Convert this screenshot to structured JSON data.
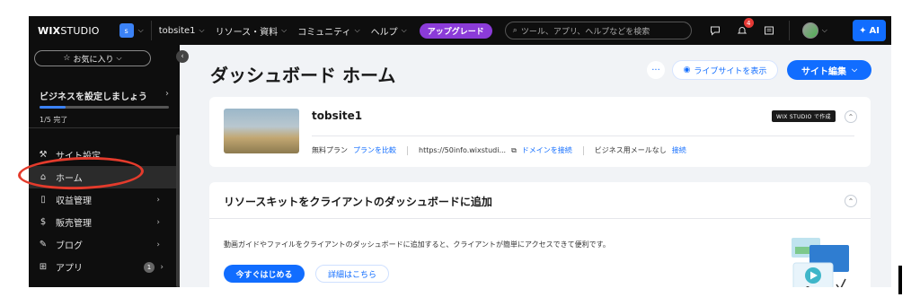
{
  "topbar": {
    "logo_bold": "WIX",
    "logo_light": "STUDIO",
    "workspace_initial": "s",
    "site_selector": "tobsite1",
    "nav": [
      "リソース・資料",
      "コミュニティ",
      "ヘルプ"
    ],
    "upgrade": "アップグレード",
    "search_placeholder": "ツール、アプリ、ヘルプなどを検索",
    "notifications_count": "4",
    "ai_label": "AI"
  },
  "sidebar": {
    "favorites": "お気に入り",
    "setup_title": "ビジネスを設定しましょう",
    "setup_progress_text": "1/5 完了",
    "setup_progress_fraction": 0.2,
    "items": [
      {
        "label": "サイト設定",
        "icon": "wrench-icon",
        "glyph": "⚒",
        "arrow": false,
        "count": null
      },
      {
        "label": "ホーム",
        "icon": "home-icon",
        "glyph": "⌂",
        "arrow": false,
        "count": null
      },
      {
        "label": "収益管理",
        "icon": "document-icon",
        "glyph": "▯",
        "arrow": true,
        "count": null
      },
      {
        "label": "販売管理",
        "icon": "dollar-icon",
        "glyph": "$",
        "arrow": true,
        "count": null
      },
      {
        "label": "ブログ",
        "icon": "pen-icon",
        "glyph": "✎",
        "arrow": true,
        "count": null
      },
      {
        "label": "アプリ",
        "icon": "apps-icon",
        "glyph": "⊞",
        "arrow": true,
        "count": "1"
      }
    ]
  },
  "main": {
    "title": "ダッシュボード ホーム",
    "more": "···",
    "view_site": "ライブサイトを表示",
    "edit_site": "サイト編集",
    "site_card": {
      "name": "tobsite1",
      "badge": "WIX STUDIO で作成",
      "plan": "無料プラン",
      "compare_plans": "プランを比較",
      "url": "https://50info.wixstudi...",
      "connect_domain": "ドメインを接続",
      "email_status": "ビジネス用メールなし",
      "connect": "接続"
    },
    "resource_card": {
      "title": "リソースキットをクライアントのダッシュボードに追加",
      "description": "動画ガイドやファイルをクライアントのダッシュボードに追加すると、クライアントが簡単にアクセスできて便利です。",
      "start": "今すぐはじめる",
      "details": "詳細はこちら"
    }
  },
  "colors": {
    "accent": "#116dff",
    "upgrade": "#8b3bd8",
    "highlight": "#e43b2c",
    "dark": "#0e0e0e"
  }
}
